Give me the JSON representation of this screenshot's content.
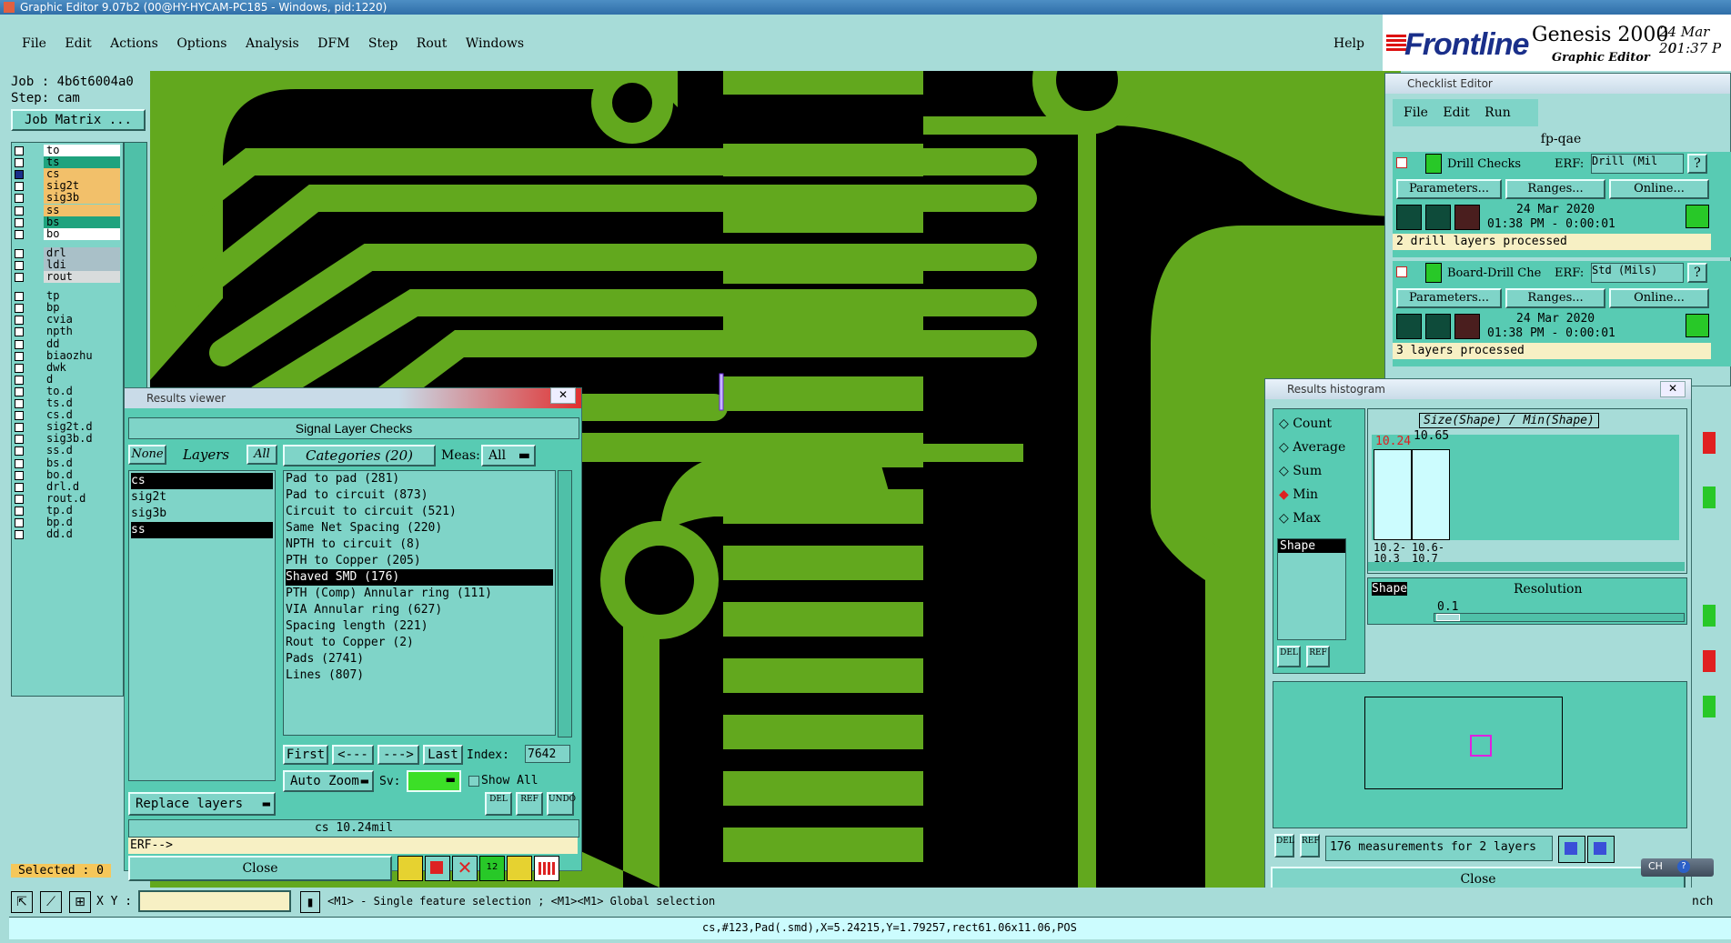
{
  "window_title": "Graphic Editor 9.07b2 (00@HY-HYCAM-PC185 - Windows, pid:1220)",
  "menu": {
    "file": "File",
    "edit": "Edit",
    "actions": "Actions",
    "options": "Options",
    "analysis": "Analysis",
    "dfm": "DFM",
    "step": "Step",
    "rout": "Rout",
    "windows": "Windows",
    "help": "Help"
  },
  "brand": {
    "frontline": "Frontline",
    "product": "Genesis 2000",
    "subtitle": "Graphic Editor",
    "date": "24 Mar 20",
    "time": "01:37 P"
  },
  "job": {
    "job": "Job : 4b6t6004a0",
    "step": "Step: cam",
    "matrix": "Job Matrix ..."
  },
  "layers_group1": [
    {
      "name": "to",
      "color": "#ffffff"
    },
    {
      "name": "ts",
      "color": "#1fa37e"
    },
    {
      "name": "cs",
      "color": "#f2c06a"
    },
    {
      "name": "sig2t",
      "color": "#f2c06a"
    },
    {
      "name": "sig3b",
      "color": "#f2c06a"
    },
    {
      "name": "ss",
      "color": "#f2c06a"
    },
    {
      "name": "bs",
      "color": "#1fa37e"
    },
    {
      "name": "bo",
      "color": "#ffffff"
    }
  ],
  "layers_group2": [
    {
      "name": "drl",
      "color": "#a9c0c8"
    },
    {
      "name": "ldi",
      "color": "#a9c0c8"
    },
    {
      "name": "rout",
      "color": "#d8dcdc"
    }
  ],
  "layers_group3": [
    "tp",
    "bp",
    "cvia",
    "npth",
    "dd",
    "biaozhu",
    "dwk",
    "d",
    "to.d",
    "ts.d",
    "cs.d",
    "sig2t.d",
    "sig3b.d",
    "ss.d",
    "bs.d",
    "bo.d",
    "drl.d",
    "rout.d",
    "tp.d",
    "bp.d",
    "dd.d"
  ],
  "selected": "Selected : 0",
  "results_viewer": {
    "title": "Results viewer",
    "header": "Signal Layer Checks",
    "none": "None",
    "layers": "Layers",
    "all": "All",
    "categories": "Categories (20)",
    "meas": "Meas:",
    "meas_value": "All",
    "layer_list": [
      "cs",
      "sig2t",
      "sig3b",
      "ss"
    ],
    "category_list": [
      "Pad to pad (281)",
      "Pad to circuit (873)",
      "Circuit to circuit (521)",
      "Same Net Spacing (220)",
      "NPTH to circuit (8)",
      "PTH to Copper (205)",
      "Shaved SMD (176)",
      "PTH (Comp) Annular ring (111)",
      "VIA Annular ring (627)",
      "Spacing length (221)",
      "Rout to Copper (2)",
      "Pads (2741)",
      "Lines (807)"
    ],
    "first": "First",
    "prev": "<---",
    "next": "--->",
    "last": "Last",
    "index_label": "Index:",
    "index_value": "7642",
    "auto_zoom": "Auto Zoom",
    "sv": "Sv:",
    "show_all": "Show All",
    "replace_layers": "Replace layers",
    "del": "DEL",
    "ref": "REF",
    "undo": "UNDO",
    "status": "cs 10.24mil",
    "erf": "ERF-->",
    "close": "Close"
  },
  "checklist": {
    "title": "Checklist Editor",
    "file": "File",
    "edit": "Edit",
    "run": "Run",
    "name": "fp-qae",
    "erf": "ERF:",
    "q": "?",
    "items": [
      {
        "name": "Drill Checks",
        "erf_value": "Drill (Mil",
        "params": "Parameters...",
        "ranges": "Ranges...",
        "online": "Online...",
        "date": "24 Mar 2020",
        "time": "01:38 PM - 0:00:01",
        "status": "2 drill layers processed"
      },
      {
        "name": "Board-Drill Che",
        "erf_value": "Std (Mils)",
        "params": "Parameters...",
        "ranges": "Ranges...",
        "online": "Online...",
        "date": "24 Mar 2020",
        "time": "01:38 PM - 0:00:01",
        "status": "3 layers processed"
      }
    ]
  },
  "histogram": {
    "title": "Results histogram",
    "options": [
      "Count",
      "Average",
      "Sum",
      "Min",
      "Max"
    ],
    "selected_option": "Min",
    "shape": "Shape",
    "chart_title": "Size(Shape) / Min(Shape)",
    "bars": [
      {
        "value": "10.24",
        "label": "10.2-10.3",
        "fraction": 1.0
      },
      {
        "value": "10.65",
        "label": "10.6-10.7",
        "fraction": 1.0
      }
    ],
    "resolution_label": "Resolution",
    "resolution_value": "0.1",
    "summary": "176 measurements for 2 layers",
    "close": "Close"
  },
  "statusbar": {
    "xy": "X Y :",
    "hint": "<M1> - Single feature selection ; <M1><M1> Global selection",
    "info": "cs,#123,Pad(.smd),X=5.24215,Y=1.79257,rect61.06x11.06,POS"
  },
  "tray": {
    "lang": "CH",
    "edge_text": "nch"
  }
}
